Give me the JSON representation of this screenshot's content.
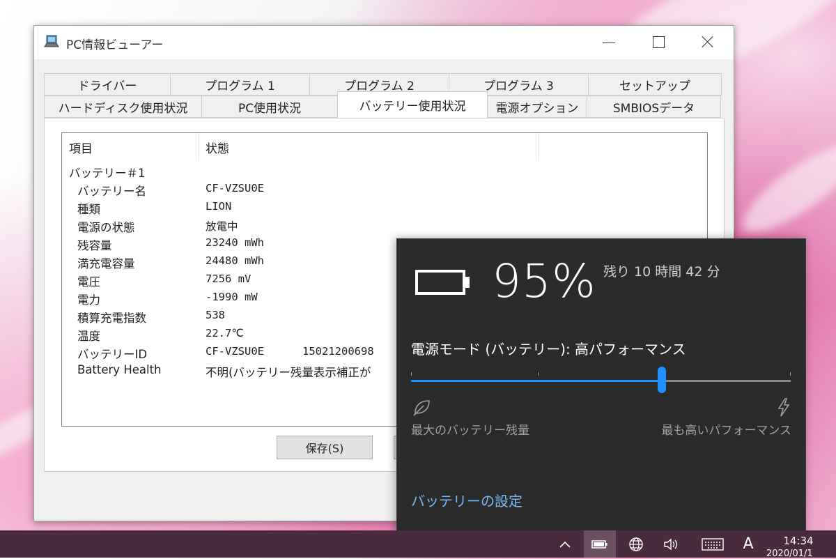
{
  "window": {
    "title": "PC情報ビューアー",
    "tabs_row1": [
      "ドライバー",
      "プログラム 1",
      "プログラム 2",
      "プログラム 3",
      "セットアップ"
    ],
    "tabs_row2": [
      "ハードディスク使用状況",
      "PC使用状況",
      "バッテリー使用状況",
      "電源オプション",
      "SMBIOSデータ"
    ],
    "active_tab": "バッテリー使用状況",
    "list": {
      "columns": [
        "項目",
        "状態"
      ],
      "group": "バッテリー＃1",
      "rows": [
        {
          "key": "バッテリー名",
          "value": "CF-VZSU0E"
        },
        {
          "key": "種類",
          "value": "LION"
        },
        {
          "key": "電源の状態",
          "value": "放電中"
        },
        {
          "key": "残容量",
          "value": "23240 mWh"
        },
        {
          "key": "満充電容量",
          "value": "24480 mWh"
        },
        {
          "key": "電圧",
          "value": "7256 mV"
        },
        {
          "key": "電力",
          "value": "-1990 mW"
        },
        {
          "key": "積算充電指数",
          "value": "538"
        },
        {
          "key": "温度",
          "value": "22.7℃"
        },
        {
          "key": "バッテリーID",
          "value": "CF-VZSU0E",
          "value2": "15021200698"
        },
        {
          "key": "Battery Health",
          "value": "不明(バッテリー残量表示補正が"
        }
      ]
    },
    "save_button": "保存(S)"
  },
  "battery_flyout": {
    "percent": "95%",
    "remaining": "残り 10 時間 42 分",
    "power_mode": "電源モード (バッテリー): 高パフォーマンス",
    "slider_level": 0.66,
    "label_min": "最大のバッテリー残量",
    "label_max": "最も高いパフォーマンス",
    "settings_link": "バッテリーの設定",
    "accent_color": "#1e90ff"
  },
  "taskbar": {
    "time": "14:34",
    "date": "2020/01/1",
    "ime_label": "A",
    "icons": [
      "chevron-up-icon",
      "battery-icon",
      "globe-icon",
      "volume-icon",
      "keyboard-icon"
    ]
  }
}
